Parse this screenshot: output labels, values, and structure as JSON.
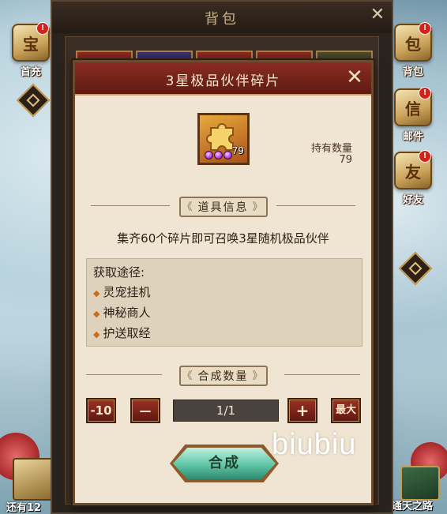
{
  "background": {
    "left_icons": [
      {
        "label": "首充",
        "glyph": "treasure-icon",
        "badge": "!"
      }
    ],
    "right_icons": [
      {
        "label": "背包",
        "glyph": "backpack-icon",
        "badge": "!"
      },
      {
        "label": "邮件",
        "glyph": "mail-icon",
        "badge": "!"
      },
      {
        "label": "好友",
        "glyph": "friends-icon",
        "badge": "!"
      }
    ],
    "left_bottom_label": "还有12",
    "right_bottom_label": "通天之路"
  },
  "bag_window": {
    "title": "背包",
    "close_symbol": "✕"
  },
  "dialog": {
    "title": "3星极品伙伴碎片",
    "close_symbol": "✕",
    "item": {
      "icon": "puzzle-piece-icon",
      "count": "79",
      "stars": 3
    },
    "hold_label": "持有数量",
    "hold_value": "79",
    "info_section_title": "道具信息",
    "description": "集齐60个碎片即可召唤3星随机极品伙伴",
    "obtain": {
      "title": "获取途径:",
      "items": [
        "灵宠挂机",
        "神秘商人",
        "护送取经"
      ]
    },
    "qty_section_title": "合成数量",
    "buttons": {
      "minus10": "-10",
      "minus": "—",
      "plus": "+",
      "max": "最大"
    },
    "qty_display": "1/1",
    "compose_label": "合成"
  },
  "watermark": "biubiu",
  "colors": {
    "header_red": "#8a2d22",
    "panel_cream": "#efe5d2",
    "compose_green": "#5fc5a6",
    "gold": "#c9a064"
  }
}
